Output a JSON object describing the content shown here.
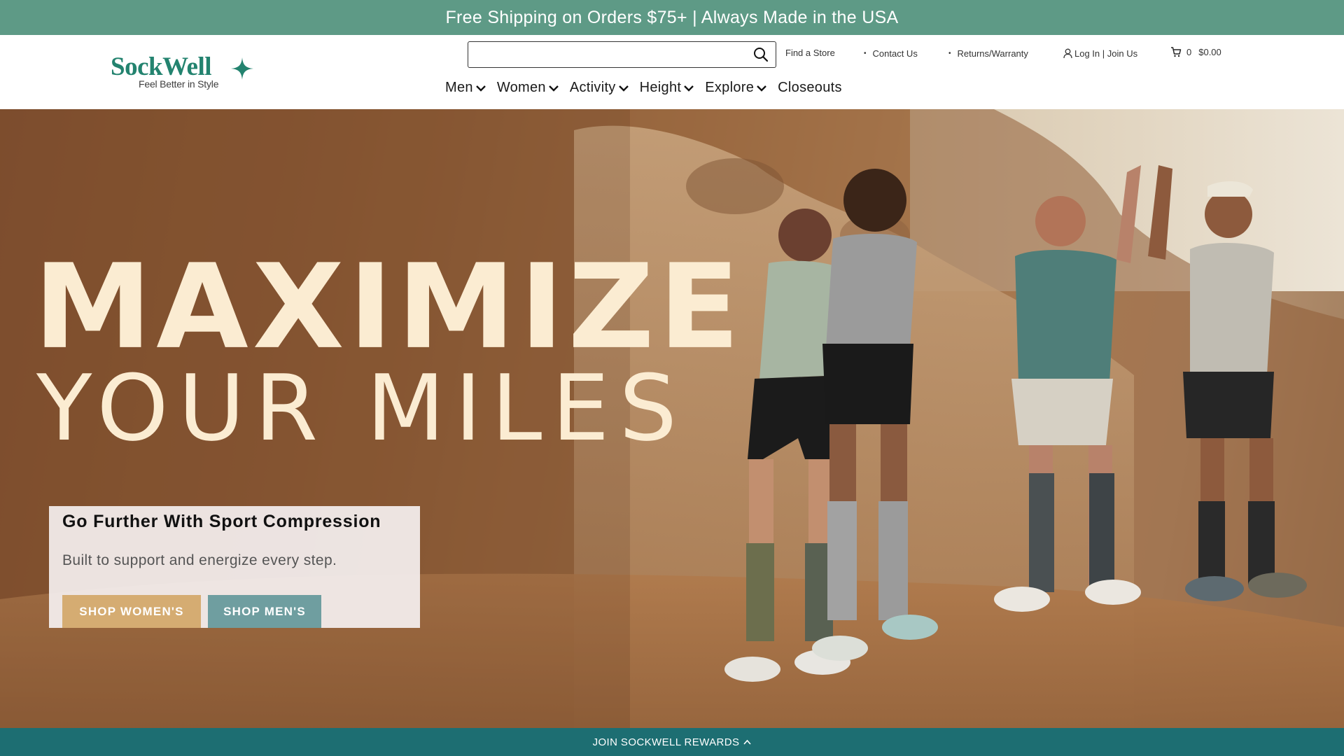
{
  "announcement": "Free Shipping on Orders $75+ | Always Made in the USA",
  "logo": {
    "name": "SockWell",
    "tagline": "Feel Better in Style",
    "color": "#23836f"
  },
  "search": {
    "placeholder": "",
    "icon": "search-icon"
  },
  "utility_links": {
    "find_store": "Find a Store",
    "contact": "Contact Us",
    "returns": "Returns/Warranty",
    "account": "Log In | Join Us",
    "cart_count": "0",
    "cart_total": "$0.00"
  },
  "nav": [
    {
      "label": "Men",
      "dropdown": true
    },
    {
      "label": "Women",
      "dropdown": true
    },
    {
      "label": "Activity",
      "dropdown": true
    },
    {
      "label": "Height",
      "dropdown": true
    },
    {
      "label": "Explore",
      "dropdown": true
    },
    {
      "label": "Closeouts",
      "dropdown": false
    }
  ],
  "hero": {
    "headline_line1": "MAXIMIZE",
    "headline_line2": "YOUR MILES",
    "promo_title": "Go Further With Sport Compression",
    "promo_subtitle": "Built to support and energize every step.",
    "button_women": "SHOP WOMEN'S",
    "button_men": "SHOP MEN'S"
  },
  "rewards_bar": "JOIN SOCKWELL REWARDS",
  "colors": {
    "announcement_bg": "#5e9a86",
    "rewards_bg": "#1d6e72",
    "button_women": "#d5ac72",
    "button_men": "#6f9ea0",
    "headline": "#fbecd2"
  }
}
